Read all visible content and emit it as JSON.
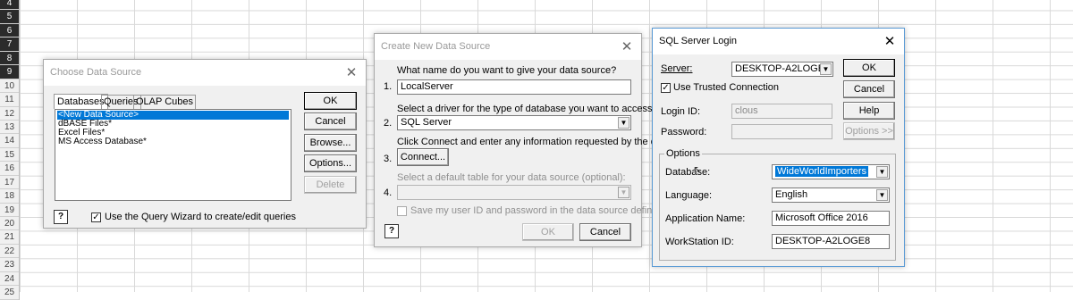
{
  "sheet": {
    "row_numbers": [
      "4",
      "5",
      "6",
      "7",
      "8",
      "9",
      "10",
      "11",
      "12",
      "13",
      "14",
      "15",
      "16",
      "17",
      "18",
      "19",
      "20",
      "21",
      "22",
      "23",
      "24",
      "25"
    ]
  },
  "choose_ds": {
    "title": "Choose Data Source",
    "tabs": [
      "Databases",
      "Queries",
      "OLAP Cubes"
    ],
    "list_items": [
      "<New Data Source>",
      "dBASE Files*",
      "Excel Files*",
      "MS Access Database*"
    ],
    "ok": "OK",
    "cancel": "Cancel",
    "browse": "Browse...",
    "options": "Options...",
    "delete": "Delete",
    "help": "?",
    "wizard_checkbox": "Use the Query Wizard to create/edit queries",
    "wizard_checked": "✓"
  },
  "create_ds": {
    "title": "Create New Data Source",
    "q1": "What name do you want to give your data source?",
    "n1": "1.",
    "name_value": "LocalServer",
    "q2": "Select a driver for the type of database you want to access:",
    "n2": "2.",
    "driver_value": "SQL Server",
    "q3": "Click Connect and enter any information requested by the driver:",
    "n3": "3.",
    "connect": "Connect...",
    "q4": "Select a default table for your data source (optional):",
    "n4": "4.",
    "save_checkbox": "Save my user ID and password in the data source definition",
    "help": "?",
    "ok": "OK",
    "cancel": "Cancel"
  },
  "sql_login": {
    "title": "SQL Server Login",
    "server_label": "Server:",
    "server_value": "DESKTOP-A2LOGE8",
    "trusted_label": "Use Trusted Connection",
    "trusted_checked": "✓",
    "login_id_label": "Login ID:",
    "login_id_value": "clous",
    "password_label": "Password:",
    "ok": "OK",
    "cancel": "Cancel",
    "help": "Help",
    "options": "Options >>",
    "options_group": "Options",
    "database_label": "Database:",
    "database_value": "WideWorldImporters",
    "language_label": "Language:",
    "language_value": "English",
    "app_name_label": "Application Name:",
    "app_name_value": "Microsoft Office 2016",
    "workstation_label": "WorkStation ID:",
    "workstation_value": "DESKTOP-A2LOGE8"
  },
  "colors": {
    "selection": "#0078d7",
    "dialog_bg": "#f0f0f0",
    "active_border": "#5b9bd5"
  }
}
